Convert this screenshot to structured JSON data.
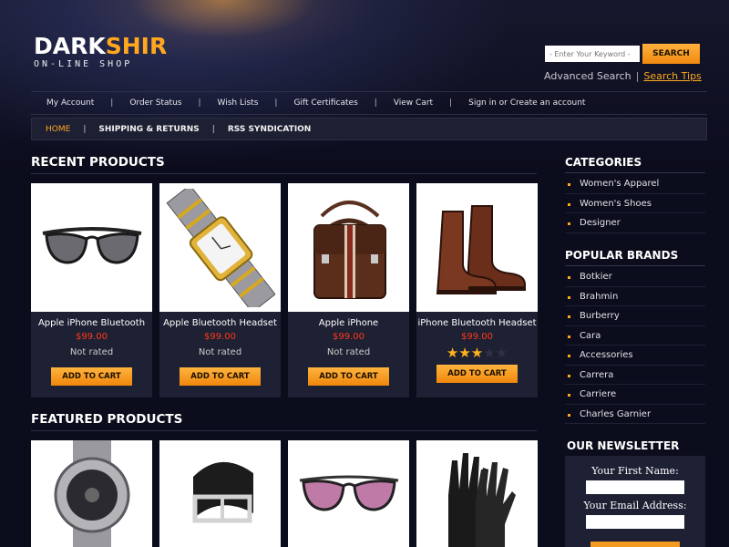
{
  "logo": {
    "part1": "DARK",
    "part2": "SHIR",
    "tagline": "ON-LINE SHOP"
  },
  "search": {
    "placeholder": "- Enter Your Keyword -",
    "button": "SEARCH",
    "advanced": "Advanced Search",
    "separator": "|",
    "tips": "Search Tips"
  },
  "topnav": {
    "items": [
      "My Account",
      "Order Status",
      "Wish Lists",
      "Gift Certificates",
      "View Cart",
      "Sign in or Create an account"
    ],
    "separator": "|"
  },
  "subnav": {
    "items": [
      "HOME",
      "SHIPPING & RETURNS",
      "RSS SYNDICATION"
    ],
    "separator": "|"
  },
  "recent": {
    "title": "RECENT PRODUCTS",
    "products": [
      {
        "name": "Apple iPhone Bluetooth",
        "price": "$99.00",
        "rating_text": "Not rated",
        "button": "ADD TO CART",
        "image": "sunglasses-icon"
      },
      {
        "name": "Apple Bluetooth Headset",
        "price": "$99.00",
        "rating_text": "Not rated",
        "button": "ADD TO CART",
        "image": "watch-icon"
      },
      {
        "name": "Apple iPhone",
        "price": "$99.00",
        "rating_text": "Not rated",
        "button": "ADD TO CART",
        "image": "briefcase-icon"
      },
      {
        "name": "iPhone Bluetooth Headset",
        "price": "$99.00",
        "stars": 3,
        "stars_max": 5,
        "button": "ADD TO CART",
        "image": "boots-icon"
      }
    ]
  },
  "featured": {
    "title": "FEATURED PRODUCTS",
    "products": [
      {
        "image": "sport-watch-icon"
      },
      {
        "image": "belt-icon"
      },
      {
        "image": "sunglasses-icon"
      },
      {
        "image": "gloves-icon"
      }
    ]
  },
  "sidebar": {
    "categories_title": "CATEGORIES",
    "categories": [
      "Women's Apparel",
      "Women's Shoes",
      "Designer"
    ],
    "brands_title": "POPULAR BRANDS",
    "brands": [
      "Botkier",
      "Brahmin",
      "Burberry",
      "Cara",
      "Accessories",
      "Carrera",
      "Carriere",
      "Charles Garnier"
    ],
    "newsletter_title": "OUR NEWSLETTER",
    "first_name_label": "Your First Name:",
    "email_label": "Your Email Address:"
  },
  "colors": {
    "accent": "#ffa81e",
    "price": "#ff3a1a",
    "background": "#0b0c1c"
  }
}
